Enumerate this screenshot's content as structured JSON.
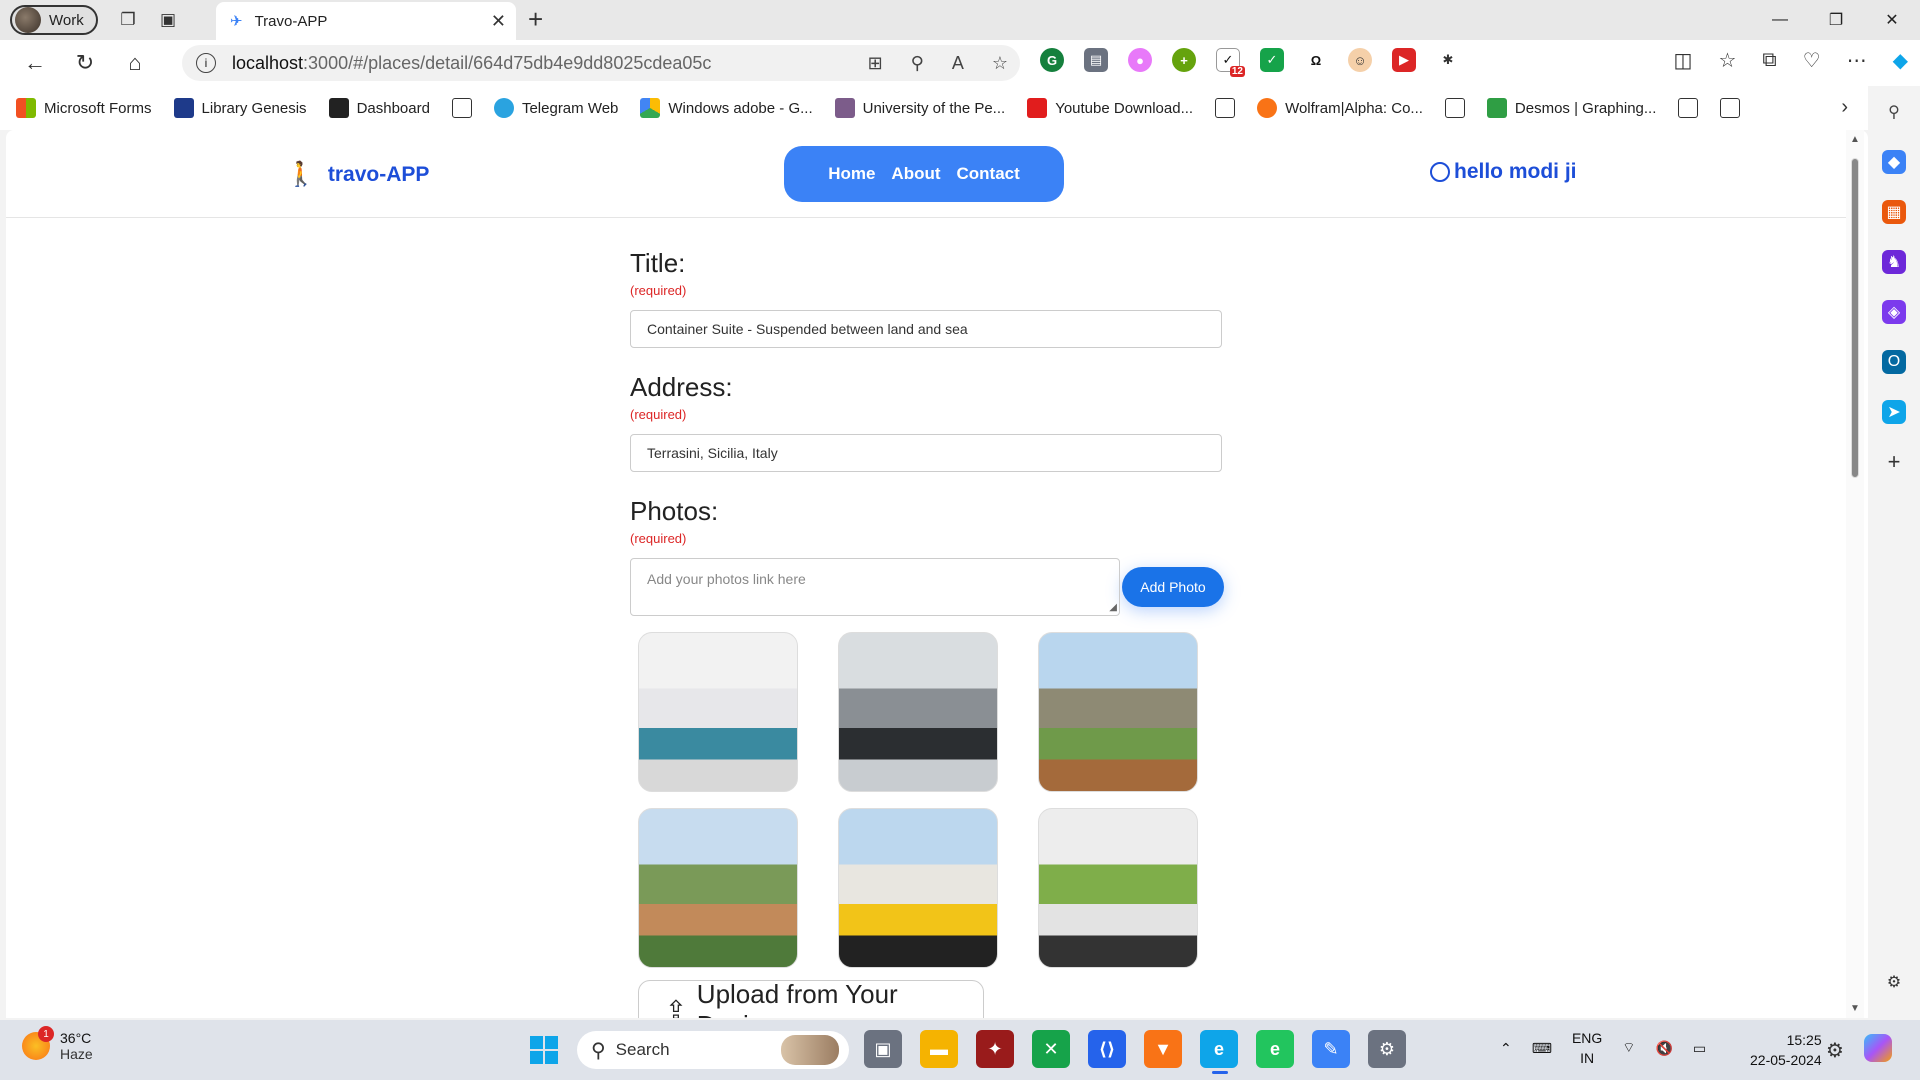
{
  "browser": {
    "profile_label": "Work",
    "tab_title": "Travo-APP",
    "url_host": "localhost",
    "url_path": ":3000/#/places/detail/664d75db4e9dd8025cdea05c",
    "extension_badge": "12"
  },
  "bookmarks": [
    {
      "label": "Microsoft Forms",
      "color": "#e24a2b"
    },
    {
      "label": "Library Genesis",
      "color": "#1e3a8a"
    },
    {
      "label": "Dashboard",
      "color": "#222222"
    },
    {
      "label": "",
      "color": "#ffffff"
    },
    {
      "label": "Telegram Web",
      "color": "#2aa3e0"
    },
    {
      "label": "Windows adobe - G...",
      "color": "#1faa56"
    },
    {
      "label": "University of the Pe...",
      "color": "#7c5c8a"
    },
    {
      "label": "Youtube Download...",
      "color": "#e11d1d"
    },
    {
      "label": "",
      "color": "#ffffff"
    },
    {
      "label": "Wolfram|Alpha: Co...",
      "color": "#f97316"
    },
    {
      "label": "",
      "color": "#ffffff"
    },
    {
      "label": "Desmos | Graphing...",
      "color": "#2f9e44"
    },
    {
      "label": "",
      "color": "#ffffff"
    },
    {
      "label": "",
      "color": "#ffffff"
    }
  ],
  "site": {
    "logo_text": "travo-APP",
    "nav": [
      "Home",
      "About",
      "Contact"
    ],
    "user_text": "hello modi ji"
  },
  "form": {
    "title_label": "Title:",
    "title_required": "(required)",
    "title_value": "Container Suite - Suspended between land and sea",
    "address_label": "Address:",
    "address_required": "(required)",
    "address_value": "Terrasini, Sicilia, Italy",
    "photos_label": "Photos:",
    "photos_required": "(required)",
    "photos_placeholder": "Add your photos link here",
    "add_photo_label": "Add Photo",
    "upload_label": "Upload from Your Device"
  },
  "photos": [
    {
      "name": "photo-1",
      "colors": [
        "#f2f2f2",
        "#e7e7ea",
        "#3a8aa0",
        "#d8d8d8"
      ]
    },
    {
      "name": "photo-2",
      "colors": [
        "#d9dde0",
        "#8a8f94",
        "#2b2e31",
        "#c8ccd0"
      ]
    },
    {
      "name": "photo-3",
      "colors": [
        "#b9d6ee",
        "#8e8a74",
        "#6f9a4a",
        "#a46a3b"
      ]
    },
    {
      "name": "photo-4",
      "colors": [
        "#c7dcef",
        "#7a9a58",
        "#c28a5a",
        "#4f7a3a"
      ]
    },
    {
      "name": "photo-5",
      "colors": [
        "#bcd7ee",
        "#e8e6e0",
        "#f2c418",
        "#222222"
      ]
    },
    {
      "name": "photo-6",
      "colors": [
        "#ededed",
        "#7fae4a",
        "#e3e3e3",
        "#333333"
      ]
    }
  ],
  "taskbar": {
    "weather_temp": "36°C",
    "weather_desc": "Haze",
    "weather_badge": "1",
    "search_label": "Search",
    "lang_1": "ENG",
    "lang_2": "IN",
    "time": "15:25",
    "date": "22-05-2024"
  }
}
